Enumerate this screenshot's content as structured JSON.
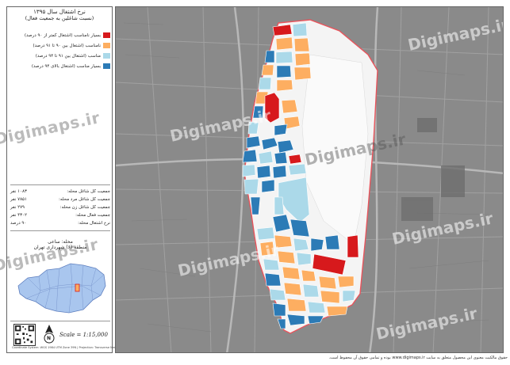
{
  "panel": {
    "title": "نرخ اشتغال سال ۱۳۹۵",
    "subtitle": "(نسبت شاغلین به جمعیت فعال)"
  },
  "legend": [
    {
      "label": "بسیار نامناسب (اشتغال کمتر از ۹۰ درصد)",
      "color": "#d7191c"
    },
    {
      "label": "نامناسب (اشتغال بین ۹۰ تا ۹۱ درصد)",
      "color": "#fdae61"
    },
    {
      "label": "مناسب (اشتغال بین ۹۱ تا ۹۴ درصد)",
      "color": "#abd9e9"
    },
    {
      "label": "بسیار مناسب (اشتغال بالای ۹۴ درصد)",
      "color": "#2c7bb6"
    }
  ],
  "stats": [
    {
      "label": "جمعیت کل شاغل محله:",
      "value": "۱۰۸۳ نفر"
    },
    {
      "label": "جمعیت کل شاغل مرد محله:",
      "value": "۷۸۵۱ نفر"
    },
    {
      "label": "جمعیت کل شاغل زن محله:",
      "value": "۲۷۹ نفر"
    },
    {
      "label": "جمعیت فعال محله:",
      "value": "۴۳۰۲ نفر"
    },
    {
      "label": "نرخ اشتغال محله:",
      "value": "۹۰ درصد"
    }
  ],
  "locator": {
    "neighborhood": "محله: ساعی",
    "district": "منطقه (۶) شهرداری تهران"
  },
  "scale": "Scale = 1:15,000",
  "north_label": "N",
  "footer_small": "Coordinate System: WGS 1984 UTM Zone 39N | Projection: Transverse Mercator",
  "watermark": "Digimaps.ir",
  "bottom_note": "حقوق مالکیت معنوی این محصول متعلق به سایت www.digimaps.ir بوده و تمامی حقوق آن محفوظ است.",
  "colors": {
    "very_poor": "#d7191c",
    "poor": "#fdae61",
    "good": "#abd9e9",
    "very_good": "#2c7bb6",
    "boundary": "#e8545c",
    "basemap": "#8b8b8b"
  },
  "icons": [
    "north-arrow-icon",
    "qr-code-icon"
  ]
}
